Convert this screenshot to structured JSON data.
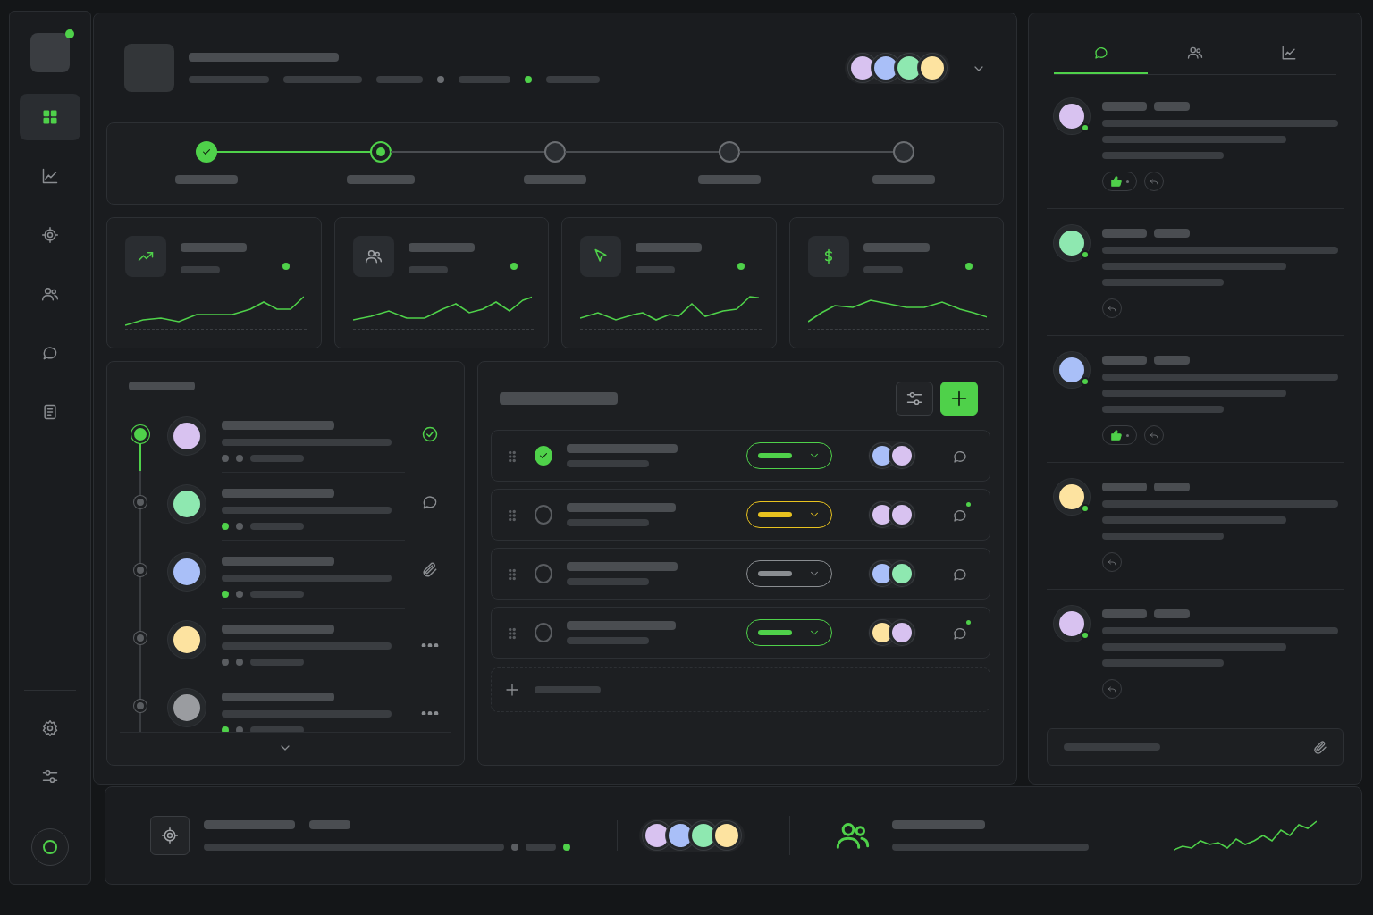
{
  "sidebar": {
    "logo_online": true,
    "items": [
      {
        "kind": "dashboard",
        "selected": true
      },
      {
        "kind": "chart",
        "selected": false
      },
      {
        "kind": "target",
        "selected": false
      },
      {
        "kind": "users",
        "selected": false
      },
      {
        "kind": "chat",
        "selected": false
      },
      {
        "kind": "document",
        "selected": false
      }
    ],
    "bottom_items": [
      {
        "kind": "settings"
      },
      {
        "kind": "sliders"
      }
    ],
    "status_on": true
  },
  "header": {
    "meta_dots": [
      {
        "color": "#6b6e72"
      },
      {
        "color": "#4fd14a"
      }
    ],
    "team": [
      {
        "color": "#d8c2f0"
      },
      {
        "color": "#a9bff8"
      },
      {
        "color": "#8ee8b0"
      },
      {
        "color": "#fde3a0"
      }
    ]
  },
  "stepper": [
    {
      "done": true,
      "current": false
    },
    {
      "done": false,
      "current": true
    },
    {
      "done": false,
      "current": false
    },
    {
      "done": false,
      "current": false
    },
    {
      "done": false,
      "current": false
    }
  ],
  "stats": [
    {
      "kind": "trend"
    },
    {
      "kind": "users"
    },
    {
      "kind": "pointer"
    },
    {
      "kind": "dollar"
    }
  ],
  "activity": [
    {
      "color": "#d8c2f0",
      "selected": true,
      "online": false,
      "kind": "check"
    },
    {
      "color": "#8ee8b0",
      "selected": false,
      "online": true,
      "kind": "chat"
    },
    {
      "color": "#a9bff8",
      "selected": false,
      "online": true,
      "kind": "clip"
    },
    {
      "color": "#fde3a0",
      "selected": false,
      "online": false,
      "kind": "more"
    },
    {
      "color": "#9a9ca0",
      "selected": false,
      "online": true,
      "kind": "more"
    }
  ],
  "tasks": [
    {
      "checked": true,
      "color": "#4fd14a",
      "assignees": [
        {
          "color": "#a9bff8"
        },
        {
          "color": "#d8c2f0"
        }
      ],
      "unread": false
    },
    {
      "checked": false,
      "color": "#e8c21f",
      "assignees": [
        {
          "color": "#d8c2f0"
        },
        {
          "color": "#d8c2f0"
        }
      ],
      "unread": true
    },
    {
      "checked": false,
      "color": "#8a8d91",
      "assignees": [
        {
          "color": "#a9bff8"
        },
        {
          "color": "#8ee8b0"
        }
      ],
      "unread": false
    },
    {
      "checked": false,
      "color": "#4fd14a",
      "assignees": [
        {
          "color": "#fde3a0"
        },
        {
          "color": "#d8c2f0"
        }
      ],
      "unread": true
    }
  ],
  "comments_panel": {
    "tabs": [
      {
        "kind": "chat",
        "selected": true
      },
      {
        "kind": "users",
        "selected": false
      },
      {
        "kind": "chart",
        "selected": false
      }
    ],
    "comments": [
      {
        "color": "#d8c2f0",
        "liked": true
      },
      {
        "color": "#8ee8b0",
        "liked": false
      },
      {
        "color": "#a9bff8",
        "liked": true
      },
      {
        "color": "#fde3a0",
        "liked": false
      },
      {
        "color": "#d8c2f0",
        "liked": false
      }
    ]
  },
  "footer": {
    "team": [
      {
        "color": "#d8c2f0"
      },
      {
        "color": "#a9bff8"
      },
      {
        "color": "#8ee8b0"
      },
      {
        "color": "#fde3a0"
      }
    ]
  }
}
